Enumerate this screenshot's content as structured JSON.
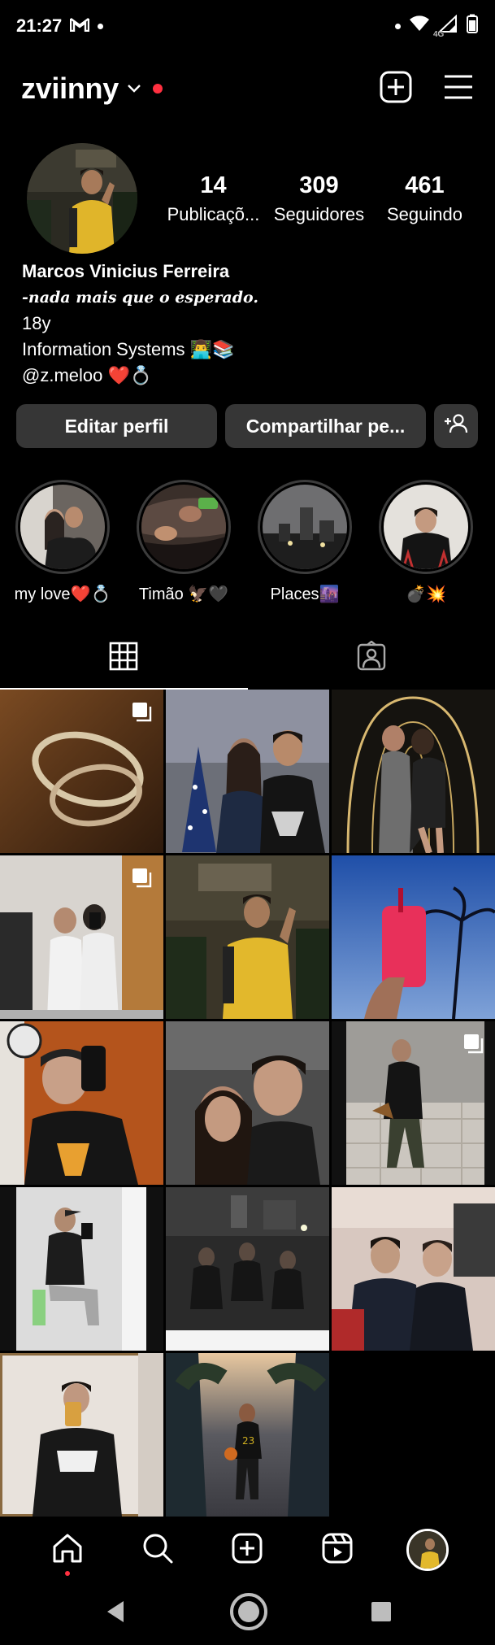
{
  "status_bar": {
    "time": "21:27",
    "gmail_icon": "gmail-icon",
    "network": "4G"
  },
  "header": {
    "username": "zviinny",
    "icons": [
      "chevron-down-icon",
      "notification-dot",
      "create-plus-icon",
      "menu-icon"
    ]
  },
  "profile": {
    "stats": [
      {
        "value": "14",
        "label": "Publicaçõ..."
      },
      {
        "value": "309",
        "label": "Seguidores"
      },
      {
        "value": "461",
        "label": "Seguindo"
      }
    ],
    "name": "Marcos Vinicius Ferreira",
    "bio": {
      "line1": "-nada mais que o esperado.",
      "line2": "18y",
      "line3": "Information Systems 👨‍💻📚",
      "line4": "@z.meloo ❤️💍"
    }
  },
  "buttons": {
    "edit_profile": "Editar perfil",
    "share_profile": "Compartilhar pe...",
    "discover_people_icon": "add-person-icon"
  },
  "highlights": [
    {
      "label": "my love❤️💍"
    },
    {
      "label": "Timão 🦅🖤"
    },
    {
      "label": "Places🌆"
    },
    {
      "label": "💣💥"
    }
  ],
  "tabs": [
    {
      "name": "grid",
      "icon": "grid-icon",
      "active": true
    },
    {
      "name": "tagged",
      "icon": "tagged-person-icon",
      "active": false
    }
  ],
  "posts": [
    {
      "multi": true
    },
    {
      "multi": false
    },
    {
      "multi": false
    },
    {
      "multi": true
    },
    {
      "multi": false
    },
    {
      "multi": false
    },
    {
      "multi": false
    },
    {
      "multi": false
    },
    {
      "multi": true
    },
    {
      "multi": false
    },
    {
      "multi": false
    },
    {
      "multi": false
    },
    {
      "multi": false
    },
    {
      "multi": false
    }
  ],
  "bottom_nav": {
    "items": [
      "home-icon",
      "search-icon",
      "create-icon",
      "reels-icon",
      "profile-avatar"
    ]
  },
  "colors": {
    "background": "#000000",
    "button": "#363636",
    "accent_red": "#ff3040"
  }
}
